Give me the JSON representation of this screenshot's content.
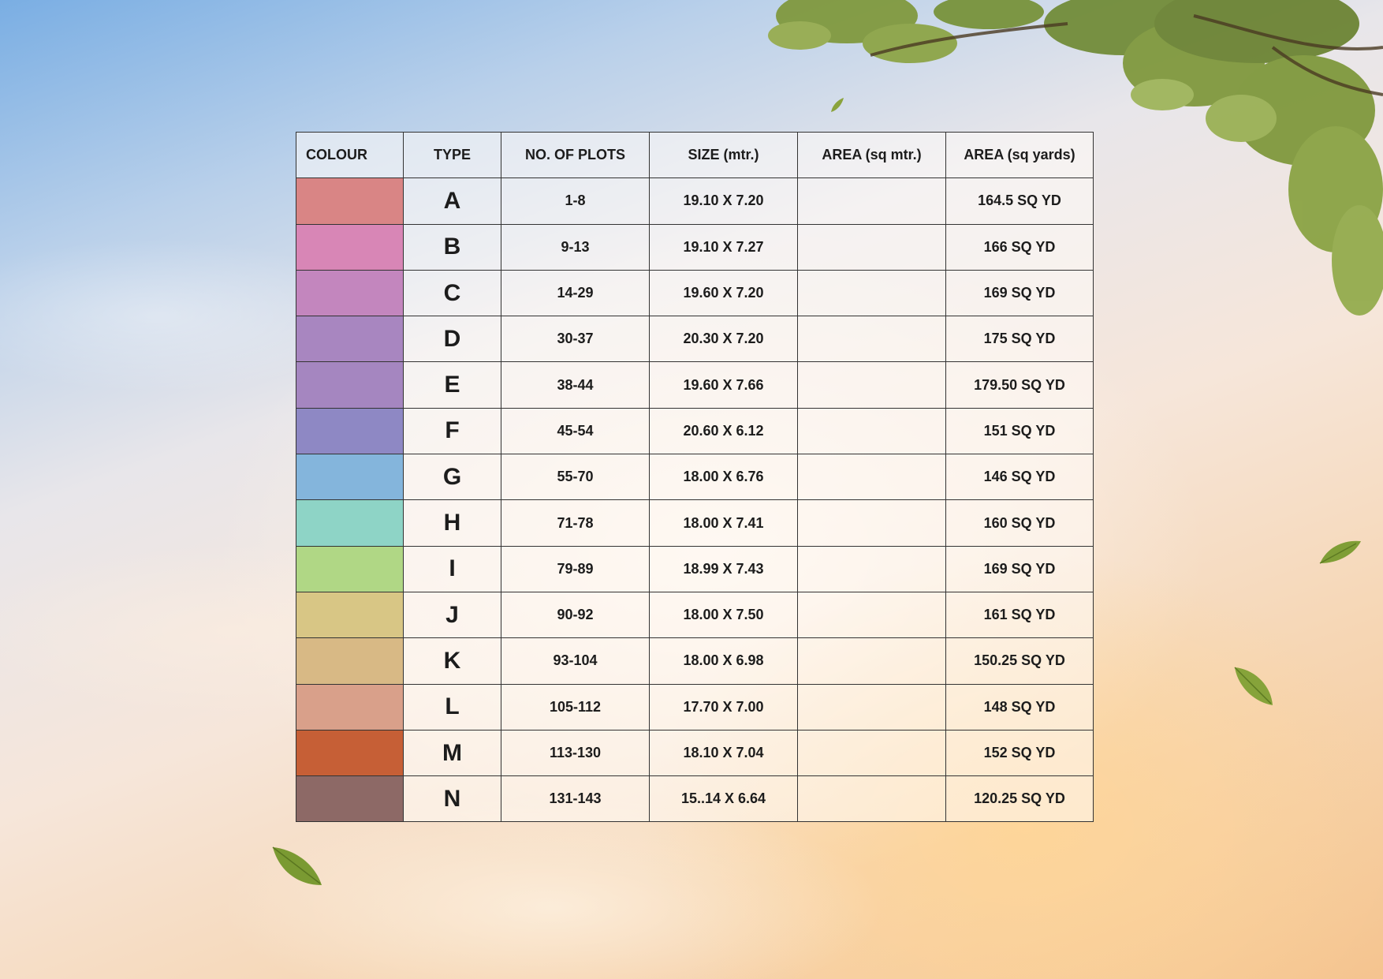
{
  "table": {
    "headers": {
      "colour": "COLOUR",
      "type": "TYPE",
      "plots": "NO. OF PLOTS",
      "size": "SIZE (mtr.)",
      "area_sqm": "AREA (sq mtr.)",
      "area_sqyd": "AREA (sq yards)"
    },
    "rows": [
      {
        "color": "#d98585",
        "type": "A",
        "plots": "1-8",
        "size": "19.10 X 7.20",
        "area_sqm": "",
        "area_sqyd": "164.5 SQ YD"
      },
      {
        "color": "#d886b6",
        "type": "B",
        "plots": "9-13",
        "size": "19.10 X 7.27",
        "area_sqm": "",
        "area_sqyd": "166 SQ YD"
      },
      {
        "color": "#c386be",
        "type": "C",
        "plots": "14-29",
        "size": "19.60 X 7.20",
        "area_sqm": "",
        "area_sqyd": "169 SQ YD"
      },
      {
        "color": "#a886c0",
        "type": "D",
        "plots": "30-37",
        "size": "20.30 X 7.20",
        "area_sqm": "",
        "area_sqyd": "175 SQ YD"
      },
      {
        "color": "#a586c0",
        "type": "E",
        "plots": "38-44",
        "size": "19.60 X 7.66",
        "area_sqm": "",
        "area_sqyd": "179.50 SQ YD"
      },
      {
        "color": "#8e88c4",
        "type": "F",
        "plots": "45-54",
        "size": "20.60 X 6.12",
        "area_sqm": "",
        "area_sqyd": "151 SQ YD"
      },
      {
        "color": "#84b5dc",
        "type": "G",
        "plots": "55-70",
        "size": "18.00 X 6.76",
        "area_sqm": "",
        "area_sqyd": "146 SQ YD"
      },
      {
        "color": "#8ed4c6",
        "type": "H",
        "plots": "71-78",
        "size": "18.00 X 7.41",
        "area_sqm": "",
        "area_sqyd": "160 SQ YD"
      },
      {
        "color": "#b0d785",
        "type": "I",
        "plots": "79-89",
        "size": "18.99 X 7.43",
        "area_sqm": "",
        "area_sqyd": "169 SQ YD"
      },
      {
        "color": "#d8c685",
        "type": "J",
        "plots": "90-92",
        "size": "18.00 X 7.50",
        "area_sqm": "",
        "area_sqyd": "161 SQ YD"
      },
      {
        "color": "#d8b985",
        "type": "K",
        "plots": "93-104",
        "size": "18.00 X 6.98",
        "area_sqm": "",
        "area_sqyd": "150.25 SQ YD"
      },
      {
        "color": "#d9a08a",
        "type": "L",
        "plots": "105-112",
        "size": "17.70 X 7.00",
        "area_sqm": "",
        "area_sqyd": "148 SQ YD"
      },
      {
        "color": "#c65f36",
        "type": "M",
        "plots": "113-130",
        "size": "18.10 X 7.04",
        "area_sqm": "",
        "area_sqyd": "152 SQ YD"
      },
      {
        "color": "#8d6966",
        "type": "N",
        "plots": "131-143",
        "size": "15..14 X 6.64",
        "area_sqm": "",
        "area_sqyd": "120.25 SQ YD"
      }
    ]
  },
  "decor": {
    "foliage": "tree-branch-icon",
    "leaves": "falling-leaf-icon"
  }
}
